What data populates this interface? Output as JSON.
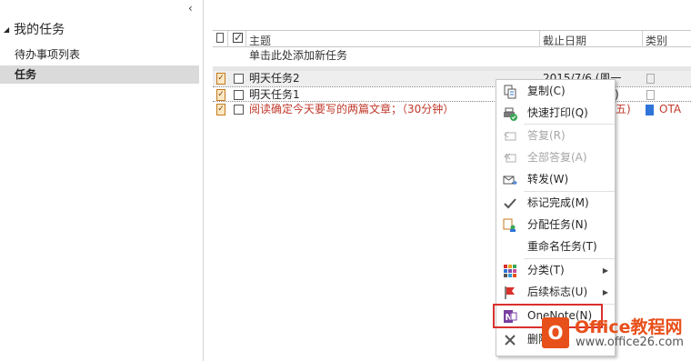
{
  "nav": {
    "header": "我的任务",
    "items": [
      {
        "label": "待办事项列表"
      },
      {
        "label": "任务"
      }
    ]
  },
  "columns": {
    "subject": "主题",
    "due_date": "截止日期",
    "category": "类别"
  },
  "new_task_placeholder": "单击此处添加新任务",
  "tasks": [
    {
      "subject": "明天任务2",
      "due": "2015/7/6 (周一",
      "category": ""
    },
    {
      "subject": "明天任务1",
      "due": "一)",
      "category": ""
    },
    {
      "subject": "阅读确定今天要写的两篇文章；（30分钟）",
      "due": "五)",
      "category": "OTA",
      "category_color": "#2e74d9",
      "status": "overdue"
    }
  ],
  "context_menu": {
    "items": [
      {
        "label": "复制(C)",
        "icon": "copy-icon",
        "enabled": true
      },
      {
        "label": "快速打印(Q)",
        "icon": "quick-print-icon",
        "enabled": true
      },
      {
        "label": "答复(R)",
        "icon": "reply-icon",
        "enabled": false
      },
      {
        "label": "全部答复(A)",
        "icon": "reply-all-icon",
        "enabled": false
      },
      {
        "label": "转发(W)",
        "icon": "forward-icon",
        "enabled": true
      },
      {
        "label": "标记完成(M)",
        "icon": "checkmark-icon",
        "enabled": true
      },
      {
        "label": "分配任务(N)",
        "icon": "assign-task-icon",
        "enabled": true
      },
      {
        "label": "重命名任务(T)",
        "icon": "",
        "enabled": true
      },
      {
        "label": "分类(T)",
        "icon": "categorize-icon",
        "enabled": true,
        "submenu": true
      },
      {
        "label": "后续标志(U)",
        "icon": "flag-icon",
        "enabled": true,
        "submenu": true
      },
      {
        "label": "OneNote(N)",
        "icon": "onenote-icon",
        "enabled": true
      },
      {
        "label": "删除",
        "icon": "delete-icon",
        "enabled": true
      }
    ]
  },
  "watermark": {
    "brand": "Office教程网",
    "url": "www.office26.com",
    "accent": "#e8501b"
  },
  "colors": {
    "overdue": "#c0392b",
    "highlight_box": "#d9302c",
    "selected_nav": "#dadada"
  }
}
